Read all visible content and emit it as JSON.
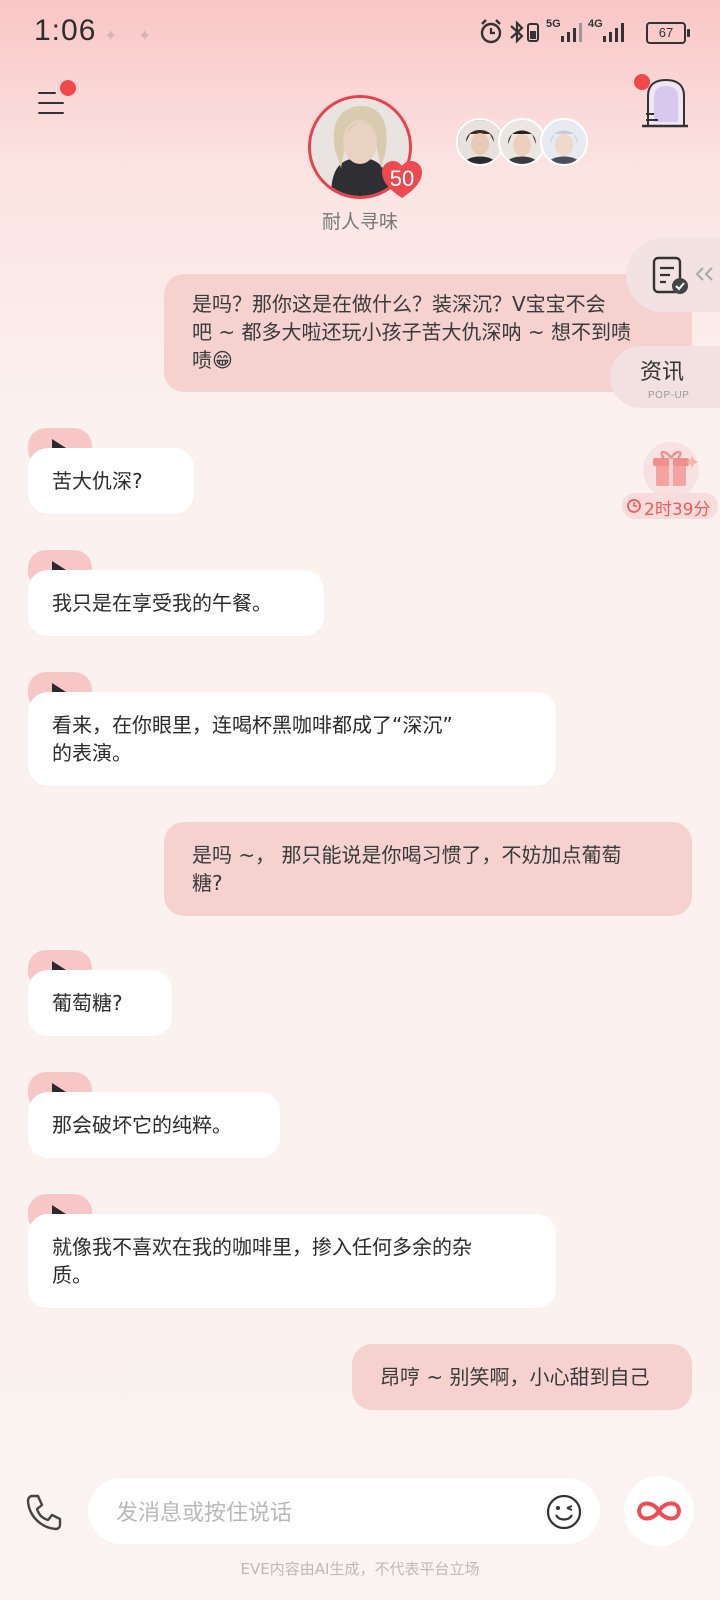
{
  "status_bar": {
    "time": "1:06",
    "signal_1": "5G",
    "signal_2": "4G",
    "battery": "67"
  },
  "header": {
    "character_name": "耐人寻味",
    "level": "50"
  },
  "side": {
    "news_label": "资讯",
    "popup_label": "POP-UP",
    "gift_timer": "2时39分"
  },
  "messages": [
    {
      "from": "me",
      "lines": [
        "是吗？那你这是在做什么？装深沉？V宝宝不会",
        "吧 ~ 都多大啦还玩小孩子苦大仇深呐 ~ 想不到啧",
        "啧😁"
      ]
    },
    {
      "from": "ai",
      "lines": [
        "苦大仇深?"
      ]
    },
    {
      "from": "ai",
      "lines": [
        "我只是在享受我的午餐。"
      ]
    },
    {
      "from": "ai",
      "lines": [
        "看来，在你眼里，连喝杯黑咖啡都成了“深沉”",
        "的表演。"
      ]
    },
    {
      "from": "me",
      "lines": [
        "是吗 ~， 那只能说是你喝习惯了，不妨加点葡萄",
        "糖?"
      ]
    },
    {
      "from": "ai",
      "lines": [
        "葡萄糖?"
      ]
    },
    {
      "from": "ai",
      "lines": [
        "那会破坏它的纯粹。"
      ]
    },
    {
      "from": "ai",
      "lines": [
        "就像我不喜欢在我的咖啡里，掺入任何多余的杂",
        "质。"
      ]
    },
    {
      "from": "me",
      "lines": [
        "昂哼 ~ 别笑啊，小心甜到自己"
      ]
    }
  ],
  "input": {
    "placeholder": "发消息或按住说话"
  },
  "footer": "EVE内容由AI生成，不代表平台立场",
  "colors": {
    "accent": "#e9424a",
    "user_bubble": "#f5d2d0",
    "ai_bubble": "#ffffff",
    "play_tab": "#f6c7c6"
  }
}
